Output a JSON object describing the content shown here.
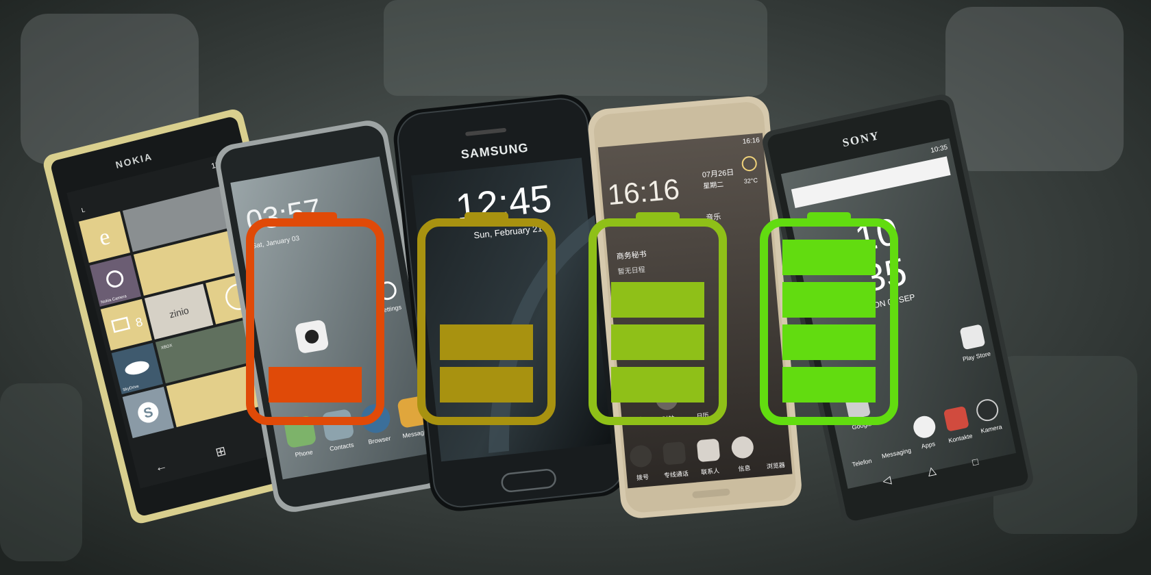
{
  "phones": [
    {
      "brand": "NOKIA",
      "time": "15:20",
      "signal_text": "L",
      "tiles": {
        "camera": "Nokia Camera",
        "mail_count": "8",
        "onedrive": "SkyDrive",
        "zinio": "zinio",
        "xbox": "XBOX"
      }
    },
    {
      "clock": "03:57",
      "date": "Sat, January 03",
      "apps": [
        "Settings",
        "Phone",
        "Contacts",
        "Browser",
        "Messaging"
      ]
    },
    {
      "brand": "SAMSUNG",
      "clock": "12:45",
      "date": "Sun, February 21"
    },
    {
      "time": "16:16",
      "clock": "16:16",
      "date": "07月26日",
      "weekday": "星期二",
      "temperature": "32°C",
      "widgets": [
        "音乐",
        "商务秘书",
        "暂无日程"
      ],
      "apps": [
        "图库",
        "时钟",
        "日历",
        "拨号",
        "专线通话",
        "联系人",
        "信息",
        "浏览器"
      ]
    },
    {
      "brand": "SONY",
      "time": "10:35",
      "clock_hours": "10",
      "clock_minutes": "35",
      "date": "MON 07 SEP",
      "apps": [
        "Play Store",
        "Google",
        "Telefon",
        "Messaging",
        "Apps",
        "Kontakte",
        "Kamera"
      ]
    }
  ],
  "batteries": [
    {
      "level_bars": 1,
      "color": "#e04a08"
    },
    {
      "level_bars": 2,
      "color": "#a89210"
    },
    {
      "level_bars": 3,
      "color": "#8fc018"
    },
    {
      "level_bars": 4,
      "color": "#62dc10"
    }
  ]
}
